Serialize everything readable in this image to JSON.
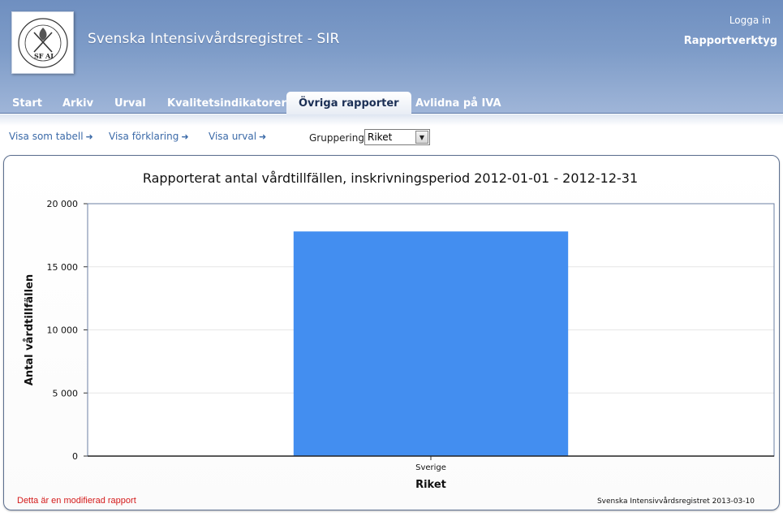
{
  "header": {
    "site_title": "Svenska Intensivvårdsregistret - SIR",
    "login_link": "Logga in",
    "tool_label": "Rapportverktyg",
    "logo_texts": [
      "SOCIETAS SVECICA",
      "SF",
      "AI"
    ]
  },
  "tabs": [
    {
      "label": "Start",
      "active": false
    },
    {
      "label": "Arkiv",
      "active": false
    },
    {
      "label": "Urval",
      "active": false
    },
    {
      "label": "Kvalitetsindikatorer",
      "active": false
    },
    {
      "label": "Övriga rapporter",
      "active": true
    },
    {
      "label": "Avlidna på IVA",
      "active": false
    }
  ],
  "controls": {
    "links": [
      "Visa som tabell",
      "Visa förklaring",
      "Visa urval"
    ],
    "arrow_glyph": "➜",
    "grouping_label": "Gruppering",
    "grouping_value": "Riket"
  },
  "chart_data": {
    "type": "bar",
    "title": "Rapporterat antal vårdtillfällen, inskrivningsperiod 2012-01-01 - 2012-12-31",
    "categories": [
      "Sverige"
    ],
    "values": [
      17800
    ],
    "xlabel": "Riket",
    "ylabel": "Antal vårdtillfällen",
    "ylim": [
      0,
      20000
    ],
    "yticks": [
      0,
      5000,
      10000,
      15000,
      20000
    ],
    "ytick_labels": [
      "0",
      "5 000",
      "10 000",
      "15 000",
      "20 000"
    ],
    "bar_color": "#438ef0",
    "grid": true
  },
  "report": {
    "modified_note": "Detta är en modifierad rapport",
    "source_note": "Svenska Intensivvårdsregistret 2013-03-10"
  },
  "colors": {
    "header_bg": "#7e9cc8",
    "active_tab_text": "#1b2f55",
    "link": "#3b6aa8",
    "warning": "#d41a1a"
  }
}
